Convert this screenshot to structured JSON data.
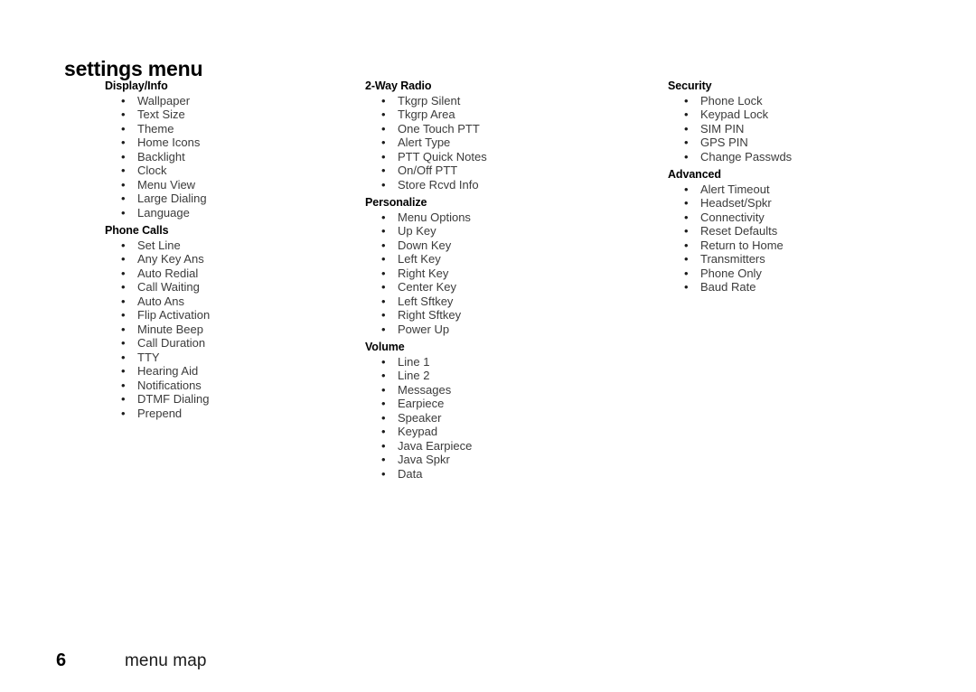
{
  "document": {
    "title": "settings menu"
  },
  "columns": [
    {
      "sections": [
        {
          "heading": "Display/Info",
          "items": [
            "Wallpaper",
            "Text Size",
            "Theme",
            "Home Icons",
            "Backlight",
            "Clock",
            "Menu View",
            "Large Dialing",
            "Language"
          ]
        },
        {
          "heading": "Phone Calls",
          "items": [
            "Set Line",
            "Any Key Ans",
            "Auto Redial",
            "Call Waiting",
            "Auto Ans",
            "Flip Activation",
            "Minute Beep",
            "Call Duration",
            "TTY",
            "Hearing Aid",
            "Notifications",
            "DTMF Dialing",
            "Prepend"
          ]
        }
      ]
    },
    {
      "sections": [
        {
          "heading": "2-Way Radio",
          "items": [
            "Tkgrp Silent",
            "Tkgrp Area",
            "One Touch PTT",
            "Alert Type",
            "PTT Quick Notes",
            "On/Off PTT",
            "Store Rcvd Info"
          ]
        },
        {
          "heading": "Personalize",
          "items": [
            "Menu Options",
            "Up Key",
            "Down Key",
            "Left Key",
            "Right Key",
            "Center Key",
            "Left Sftkey",
            "Right Sftkey",
            "Power Up"
          ]
        },
        {
          "heading": "Volume",
          "items": [
            "Line 1",
            "Line 2",
            "Messages",
            "Earpiece",
            "Speaker",
            "Keypad",
            "Java Earpiece",
            "Java Spkr",
            "Data"
          ]
        }
      ]
    },
    {
      "sections": [
        {
          "heading": "Security",
          "items": [
            "Phone Lock",
            "Keypad Lock",
            "SIM PIN",
            "GPS PIN",
            "Change Passwds"
          ]
        },
        {
          "heading": "Advanced",
          "items": [
            "Alert Timeout",
            "Headset/Spkr",
            "Connectivity",
            "Reset Defaults",
            "Return to Home",
            "Transmitters",
            "Phone Only",
            "Baud Rate"
          ]
        }
      ]
    }
  ],
  "footer": {
    "page_number": "6",
    "label": "menu map"
  },
  "bullet_glyph": "•",
  "colors": {
    "background": "#ffffff",
    "heading_text": "#000000",
    "item_text": "#3b3b3b",
    "footer_text": "#1a1a1a"
  }
}
